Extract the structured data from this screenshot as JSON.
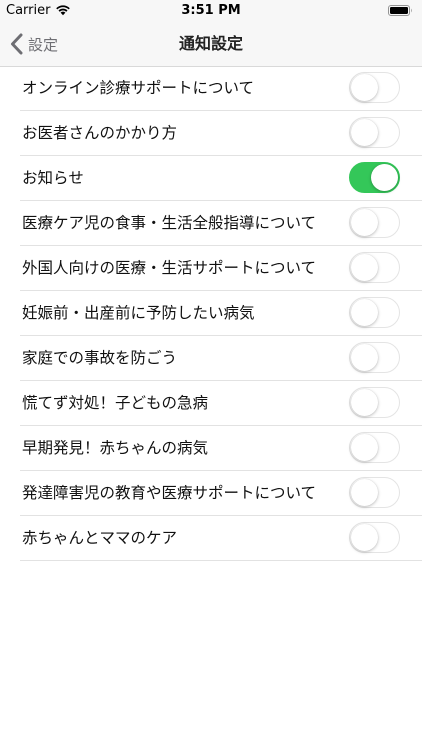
{
  "status_bar": {
    "carrier": "Carrier",
    "time": "3:51 PM",
    "wifi_icon": "wifi-icon",
    "battery_icon": "battery-icon"
  },
  "nav": {
    "back_label": "設定",
    "back_icon": "chevron-left-icon",
    "title": "通知設定"
  },
  "colors": {
    "toggle_on": "#34c759",
    "toggle_off_border": "#e4e4e4",
    "separator": "#e2e2e2",
    "nav_background": "#f7f7f7"
  },
  "settings": [
    {
      "label": "オンライン診療サポートについて",
      "enabled": false
    },
    {
      "label": "お医者さんのかかり方",
      "enabled": false
    },
    {
      "label": "お知らせ",
      "enabled": true
    },
    {
      "label": "医療ケア児の食事・生活全般指導について",
      "enabled": false
    },
    {
      "label": "外国人向けの医療・生活サポートについて",
      "enabled": false
    },
    {
      "label": "妊娠前・出産前に予防したい病気",
      "enabled": false
    },
    {
      "label": "家庭での事故を防ごう",
      "enabled": false
    },
    {
      "label": "慌てず対処！子どもの急病",
      "enabled": false
    },
    {
      "label": "早期発見！赤ちゃんの病気",
      "enabled": false
    },
    {
      "label": "発達障害児の教育や医療サポートについて",
      "enabled": false
    },
    {
      "label": "赤ちゃんとママのケア",
      "enabled": false
    }
  ]
}
